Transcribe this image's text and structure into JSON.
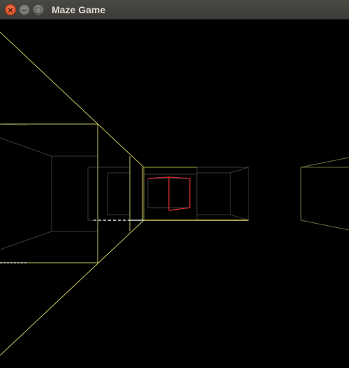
{
  "window": {
    "title": "Maze Game",
    "buttons": {
      "close_glyph": "×",
      "minimize_glyph": "−",
      "maximize_glyph": "□"
    }
  },
  "scene": {
    "background": "#000000",
    "wall_color_near": "#d8d86a",
    "wall_color_far": "#3c3c3c",
    "target_color": "#e03030"
  }
}
